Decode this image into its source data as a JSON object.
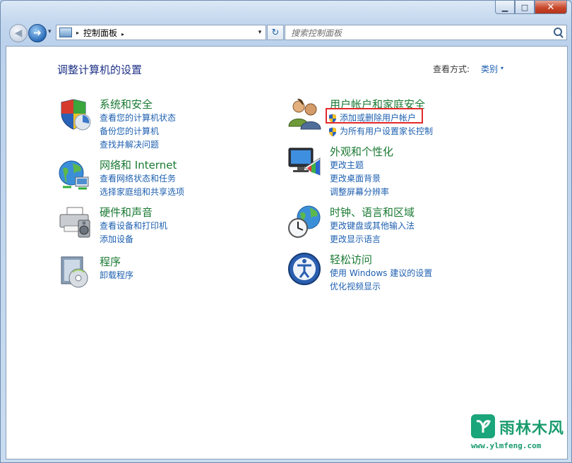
{
  "window": {
    "minimize_glyph": "▁",
    "maximize_glyph": "□",
    "close_glyph": "✕"
  },
  "navbar": {
    "back_glyph": "◀",
    "forward_glyph": "➜",
    "history_glyph": "▾",
    "address": {
      "breadcrumb_sep": "▸",
      "location": "控制面板",
      "trailing_sep": "▸",
      "dropdown_glyph": "▾"
    },
    "refresh_glyph": "↻",
    "search": {
      "placeholder": "搜索控制面板",
      "value": ""
    }
  },
  "content": {
    "title": "调整计算机的设置",
    "view_by_label": "查看方式:",
    "view_by_value": "类别",
    "view_by_arrow": "▾",
    "categories": [
      {
        "title": "系统和安全",
        "icon": "shield-icon",
        "links": [
          "查看您的计算机状态",
          "备份您的计算机",
          "查找并解决问题"
        ]
      },
      {
        "title": "网络和 Internet",
        "icon": "network-globe-icon",
        "links": [
          "查看网络状态和任务",
          "选择家庭组和共享选项"
        ]
      },
      {
        "title": "硬件和声音",
        "icon": "printer-speaker-icon",
        "links": [
          "查看设备和打印机",
          "添加设备"
        ]
      },
      {
        "title": "程序",
        "icon": "programs-disc-icon",
        "links": [
          "卸载程序"
        ]
      },
      {
        "title": "用户帐户和家庭安全",
        "icon": "users-icon",
        "links": [
          "添加或删除用户帐户",
          "为所有用户设置家长控制"
        ]
      },
      {
        "title": "外观和个性化",
        "icon": "monitor-palette-icon",
        "links": [
          "更改主题",
          "更改桌面背景",
          "调整屏幕分辨率"
        ]
      },
      {
        "title": "时钟、语言和区域",
        "icon": "clock-globe-icon",
        "links": [
          "更改键盘或其他输入法",
          "更改显示语言"
        ]
      },
      {
        "title": "轻松访问",
        "icon": "ease-of-access-icon",
        "links": [
          "使用 Windows 建议的设置",
          "优化视频显示"
        ]
      }
    ]
  },
  "watermark": {
    "name": "雨林木风",
    "url": "www.ylmfeng.com"
  },
  "colors": {
    "link": "#1d5fb0",
    "category_title": "#1a7a33",
    "page_title": "#1e3287",
    "highlight_border": "#e3282a"
  }
}
